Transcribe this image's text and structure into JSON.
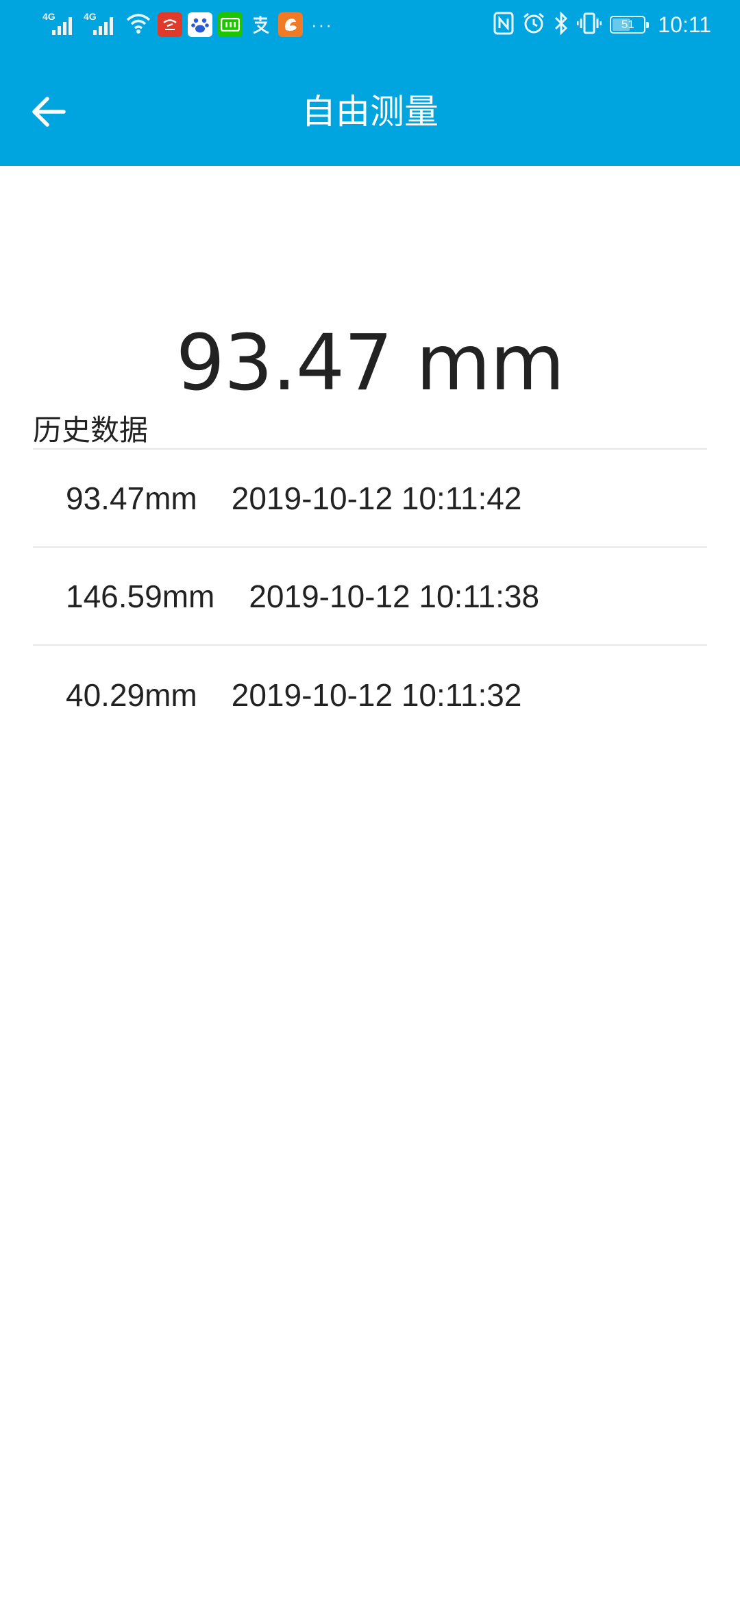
{
  "status_bar": {
    "network_1": "4G",
    "network_2": "4G",
    "more": "···",
    "battery_level": "51",
    "time": "10:11"
  },
  "app_bar": {
    "title": "自由测量"
  },
  "measurement": {
    "current": "93.47 mm"
  },
  "history": {
    "title": "历史数据",
    "items": [
      {
        "value": "93.47mm",
        "time": "2019-10-12 10:11:42"
      },
      {
        "value": "146.59mm",
        "time": "2019-10-12 10:11:38"
      },
      {
        "value": "40.29mm",
        "time": "2019-10-12 10:11:32"
      }
    ]
  },
  "colors": {
    "primary": "#00A4DF",
    "text": "#222222",
    "divider": "#E8E8E8",
    "background": "#FFFFFF"
  }
}
